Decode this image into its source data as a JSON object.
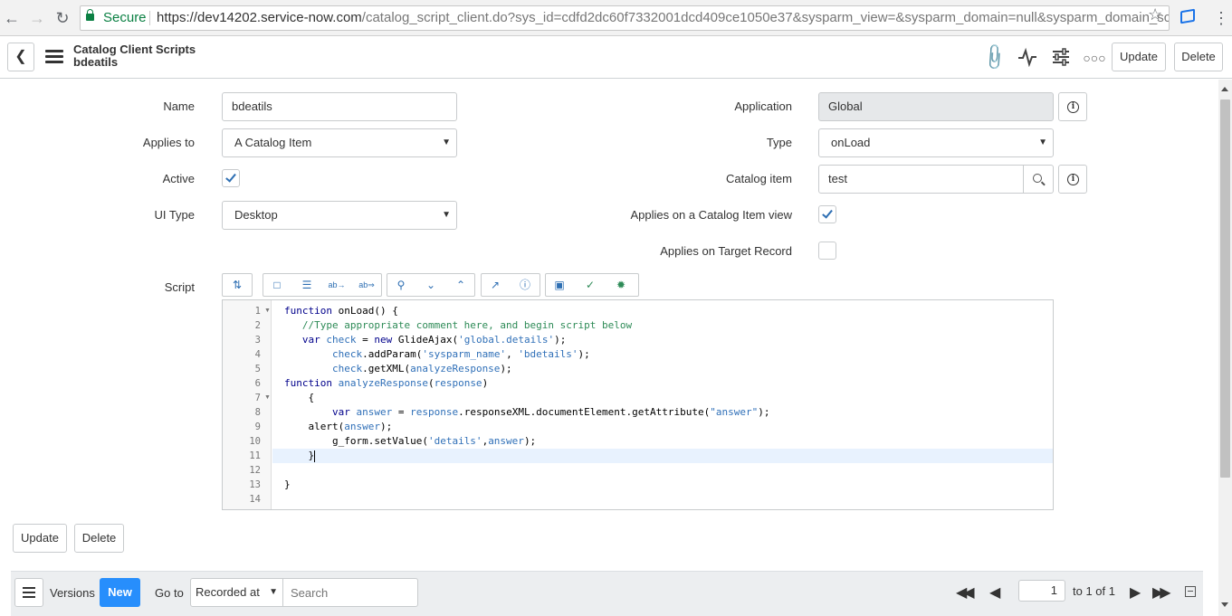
{
  "browser": {
    "secure_label": "Secure",
    "url_host": "https://dev14202.service-now.com",
    "url_path": "/catalog_script_client.do?sys_id=cdfd2dc60f7332001dcd409ce1050e37&sysparm_view=&sysparm_domain=null&sysparm_domain_scope=null"
  },
  "header": {
    "title": "Catalog Client Scripts",
    "subtitle": "bdeatils",
    "update_label": "Update",
    "delete_label": "Delete"
  },
  "form": {
    "name_label": "Name",
    "name_value": "bdeatils",
    "applies_to_label": "Applies to",
    "applies_to_value": "A Catalog Item",
    "active_label": "Active",
    "active_checked": true,
    "ui_type_label": "UI Type",
    "ui_type_value": "Desktop",
    "application_label": "Application",
    "application_value": "Global",
    "type_label": "Type",
    "type_value": "onLoad",
    "catalog_item_label": "Catalog item",
    "catalog_item_value": "test",
    "applies_catalog_view_label": "Applies on a Catalog Item view",
    "applies_catalog_view_checked": true,
    "applies_target_label": "Applies on Target Record",
    "applies_target_checked": false,
    "script_label": "Script"
  },
  "script_lines": [
    "function onLoad() {",
    "   //Type appropriate comment here, and begin script below",
    "   var check = new GlideAjax('global.details');",
    "        check.addParam('sysparm_name', 'bdetails');",
    "        check.getXML(analyzeResponse);",
    "function analyzeResponse(response)",
    "    {",
    "        var answer = response.responseXML.documentElement.getAttribute(\"answer\");",
    "    alert(answer);",
    "        g_form.setValue('details',answer);",
    "    }",
    "",
    "}",
    ""
  ],
  "line_numbers": [
    "1",
    "2",
    "3",
    "4",
    "5",
    "6",
    "7",
    "8",
    "9",
    "10",
    "11",
    "12",
    "13",
    "14"
  ],
  "footer": {
    "update_label": "Update",
    "delete_label": "Delete"
  },
  "related": {
    "versions_label": "Versions",
    "new_label": "New",
    "goto_label": "Go to",
    "goto_select": "Recorded at",
    "search_placeholder": "Search",
    "page_value": "1",
    "page_of": "to 1 of 1"
  }
}
